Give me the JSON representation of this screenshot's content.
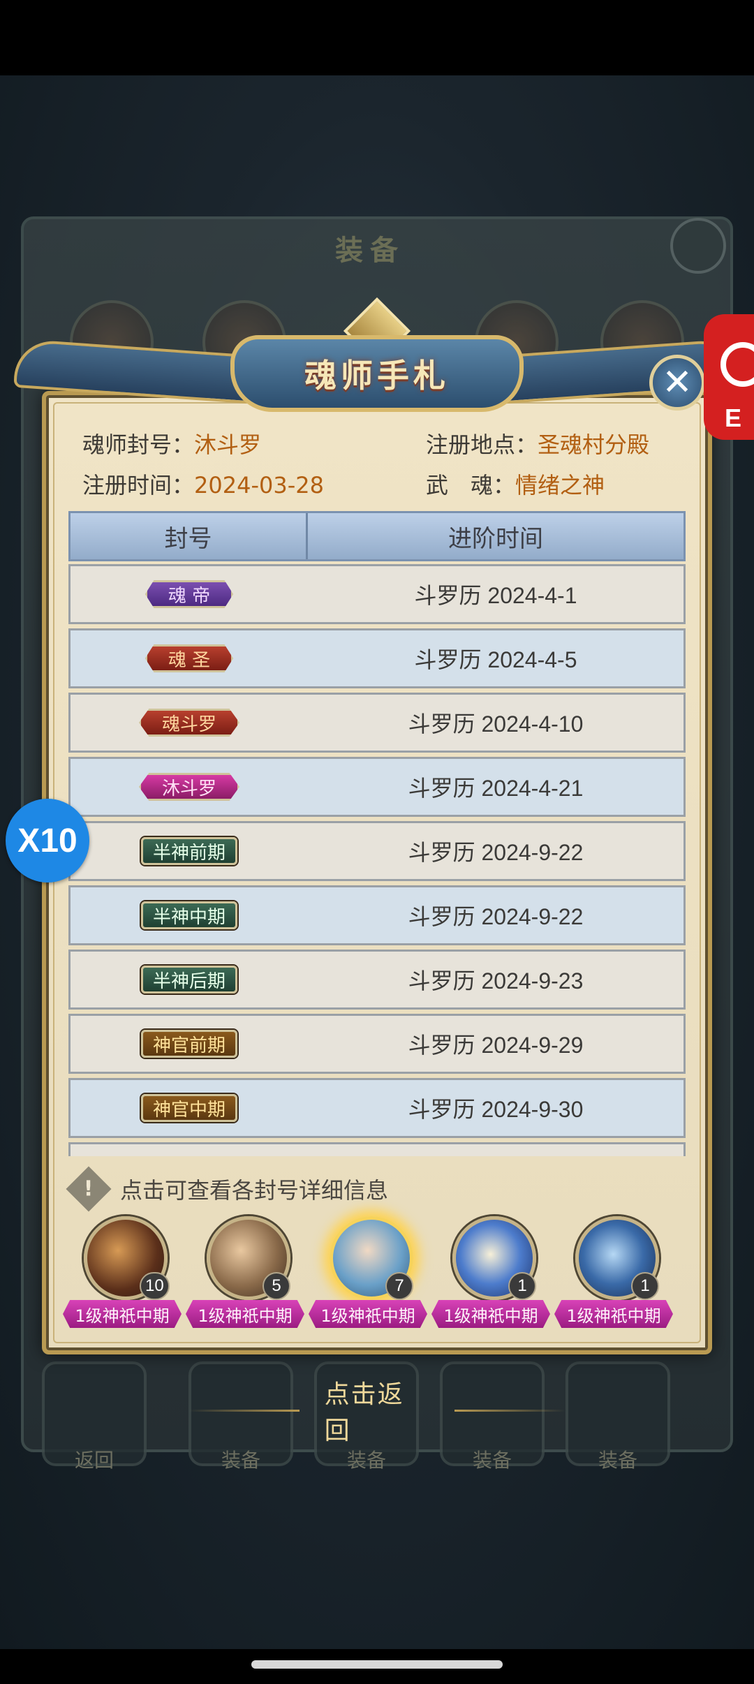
{
  "background": {
    "title": "装备",
    "bottom_slots": [
      "返回",
      "装备",
      "装备",
      "装备",
      "装备"
    ]
  },
  "overlay": {
    "speed_badge": "X10",
    "side_app_text": "E"
  },
  "dialog": {
    "title": "魂师手札",
    "info": {
      "title_label": "魂师封号：",
      "title_value": "沐斗罗",
      "reg_place_label": "注册地点：",
      "reg_place_value": "圣魂村分殿",
      "reg_time_label": "注册时间：",
      "reg_time_value": "2024-03-28",
      "soul_label": "武　魂：",
      "soul_value": "情绪之神"
    },
    "table": {
      "headers": [
        "封号",
        "进阶时间"
      ],
      "rows": [
        {
          "badge": "魂 帝",
          "style": "b-purple",
          "date": "斗罗历 2024-4-1"
        },
        {
          "badge": "魂 圣",
          "style": "b-red",
          "date": "斗罗历 2024-4-5"
        },
        {
          "badge": "魂斗罗",
          "style": "b-red",
          "date": "斗罗历 2024-4-10"
        },
        {
          "badge": "沐斗罗",
          "style": "b-magenta",
          "date": "斗罗历 2024-4-21"
        },
        {
          "badge": "半神前期",
          "style": "b-green",
          "date": "斗罗历 2024-9-22"
        },
        {
          "badge": "半神中期",
          "style": "b-green",
          "date": "斗罗历 2024-9-22"
        },
        {
          "badge": "半神后期",
          "style": "b-green",
          "date": "斗罗历 2024-9-23"
        },
        {
          "badge": "神官前期",
          "style": "b-gold",
          "date": "斗罗历 2024-9-29"
        },
        {
          "badge": "神官中期",
          "style": "b-gold",
          "date": "斗罗历 2024-9-30"
        }
      ]
    },
    "hint": "点击可查看各封号详细信息",
    "heroes": [
      {
        "count": "10",
        "tag": "1级神祇中期",
        "portrait": "p1"
      },
      {
        "count": "5",
        "tag": "1级神祇中期",
        "portrait": "p2"
      },
      {
        "count": "7",
        "tag": "1级神祇中期",
        "portrait": "p3"
      },
      {
        "count": "1",
        "tag": "1级神祇中期",
        "portrait": "p4"
      },
      {
        "count": "1",
        "tag": "1级神祇中期",
        "portrait": "p5"
      }
    ],
    "return_label": "点击返回"
  }
}
